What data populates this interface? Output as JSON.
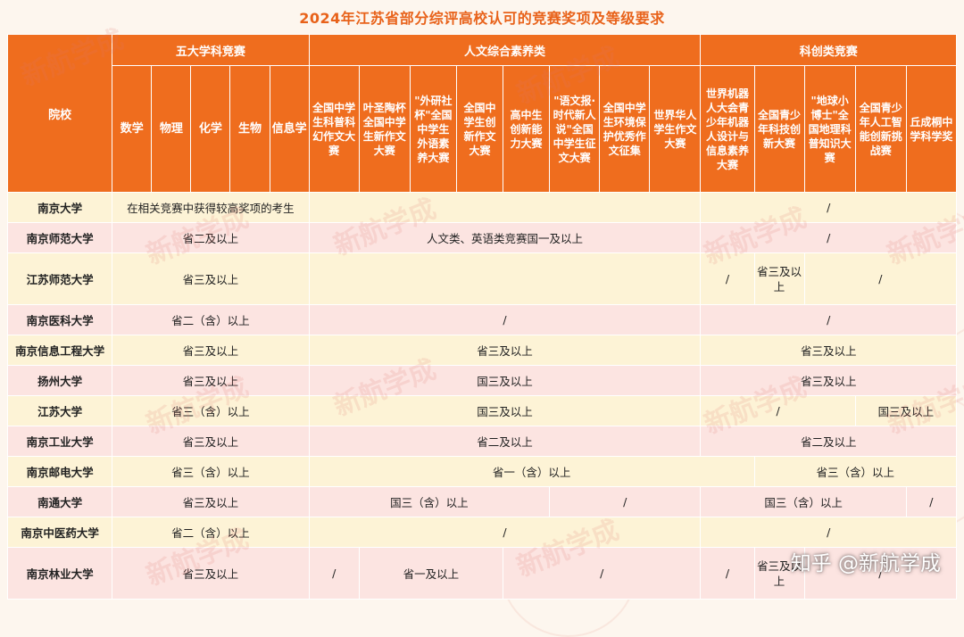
{
  "title": "2024年江苏省部分综评高校认可的竞赛奖项及等级要求",
  "watermark": "新航学成",
  "credit": "知乎 @新航学成",
  "header": {
    "corner": "院校",
    "groups": [
      "五大学科竞赛",
      "人文综合素养类",
      "科创类竞赛"
    ],
    "columns": [
      "数学",
      "物理",
      "化学",
      "生物",
      "信息学",
      "全国中学生科普科幻作文大赛",
      "叶圣陶杯全国中学生新作文大赛",
      "\"外研社杯\"全国中学生外语素养大赛",
      "全国中学生创新作文大赛",
      "高中生创新能力大赛",
      "\"语文报·时代新人说\"全国中学生征文大赛",
      "全国中学生环境保护优秀作文征集",
      "世界华人学生作文大赛",
      "世界机器人大会青少年机器人设计与信息素养大赛",
      "全国青少年科技创新大赛",
      "\"地球小博士\"全国地理科普知识大赛",
      "全国青少年人工智能创新挑战赛",
      "丘成桐中学科学奖"
    ]
  },
  "rows": [
    {
      "school": "南京大学",
      "cells": [
        "在相关竞赛中获得较高奖项的考生",
        "/"
      ]
    },
    {
      "school": "南京师范大学",
      "cells": [
        "省二及以上",
        "人文类、英语类竞赛国一及以上",
        "/"
      ]
    },
    {
      "school": "江苏师范大学",
      "cells": [
        "省三及以上",
        "",
        "/",
        "省三及以上",
        "/"
      ]
    },
    {
      "school": "南京医科大学",
      "cells": [
        "省二（含）以上",
        "/",
        "/"
      ]
    },
    {
      "school": "南京信息工程大学",
      "cells": [
        "省三及以上",
        "省三及以上",
        "省三及以上"
      ]
    },
    {
      "school": "扬州大学",
      "cells": [
        "省三及以上",
        "国三及以上",
        "省三及以上"
      ]
    },
    {
      "school": "江苏大学",
      "cells": [
        "省三（含）以上",
        "国三及以上",
        "/",
        "国三及以上"
      ]
    },
    {
      "school": "南京工业大学",
      "cells": [
        "省三及以上",
        "省二及以上",
        "省二及以上"
      ]
    },
    {
      "school": "南京邮电大学",
      "cells": [
        "省三（含）以上",
        "省一（含）以上",
        "省三（含）以上"
      ]
    },
    {
      "school": "南通大学",
      "cells": [
        "省三及以上",
        "国三（含）以上",
        "/",
        "国三（含）以上",
        "/"
      ]
    },
    {
      "school": "南京中医药大学",
      "cells": [
        "省二（含）以上",
        "/",
        "/"
      ]
    },
    {
      "school": "南京林业大学",
      "cells": [
        "省三及以上",
        "/",
        "省一及以上",
        "/",
        "/",
        "省三及以上",
        "/"
      ]
    }
  ]
}
